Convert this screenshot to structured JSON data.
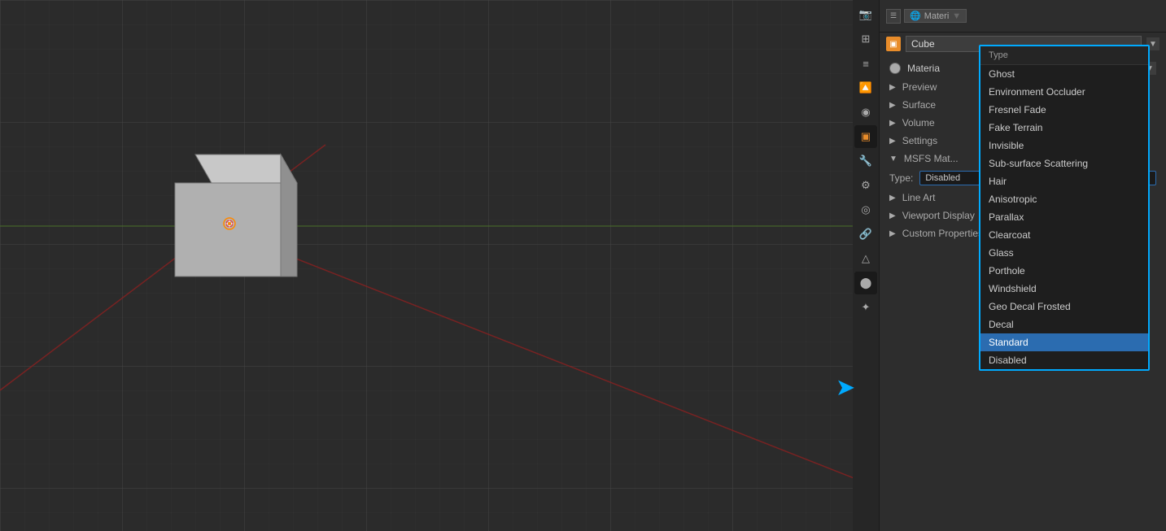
{
  "viewport": {
    "background": "#2b2b2b"
  },
  "object": {
    "name": "Cube",
    "icon": "▣"
  },
  "panel": {
    "material_name": "Materia",
    "sections": [
      {
        "label": "Preview",
        "expanded": false
      },
      {
        "label": "Surface",
        "expanded": false
      },
      {
        "label": "Volume",
        "expanded": false
      },
      {
        "label": "Settings",
        "expanded": false
      },
      {
        "label": "MSFS Mat...",
        "expanded": false
      },
      {
        "label": "Line Art",
        "expanded": false
      },
      {
        "label": "Viewport Display",
        "expanded": false
      },
      {
        "label": "Custom Properties",
        "expanded": false
      }
    ],
    "type_label": "Type:",
    "type_value": "Disabled"
  },
  "dropdown": {
    "header": "Type",
    "items": [
      {
        "label": "Ghost",
        "selected": false
      },
      {
        "label": "Environment Occluder",
        "selected": false
      },
      {
        "label": "Fresnel Fade",
        "selected": false
      },
      {
        "label": "Fake Terrain",
        "selected": false
      },
      {
        "label": "Invisible",
        "selected": false
      },
      {
        "label": "Sub-surface Scattering",
        "selected": false
      },
      {
        "label": "Hair",
        "selected": false
      },
      {
        "label": "Anisotropic",
        "selected": false
      },
      {
        "label": "Parallax",
        "selected": false
      },
      {
        "label": "Clearcoat",
        "selected": false
      },
      {
        "label": "Glass",
        "selected": false
      },
      {
        "label": "Porthole",
        "selected": false
      },
      {
        "label": "Windshield",
        "selected": false
      },
      {
        "label": "Geo Decal Frosted",
        "selected": false
      },
      {
        "label": "Decal",
        "selected": false
      },
      {
        "label": "Standard",
        "selected": true
      },
      {
        "label": "Disabled",
        "selected": false
      }
    ]
  },
  "props_icons": [
    {
      "name": "render-icon",
      "symbol": "📷",
      "active": false
    },
    {
      "name": "output-icon",
      "symbol": "⊞",
      "active": false
    },
    {
      "name": "viewlayer-icon",
      "symbol": "☰",
      "active": false
    },
    {
      "name": "scene-icon",
      "symbol": "🔼",
      "active": false
    },
    {
      "name": "world-icon",
      "symbol": "⦿",
      "active": false
    },
    {
      "name": "object-icon",
      "symbol": "▣",
      "active": false
    },
    {
      "name": "modifier-icon",
      "symbol": "🔧",
      "active": false
    },
    {
      "name": "particle-icon",
      "symbol": "⚙",
      "active": false
    },
    {
      "name": "physics-icon",
      "symbol": "◎",
      "active": false
    },
    {
      "name": "constraint-icon",
      "symbol": "🔗",
      "active": false
    },
    {
      "name": "data-icon",
      "symbol": "△",
      "active": false
    },
    {
      "name": "material-icon",
      "symbol": "⬤",
      "active": true
    },
    {
      "name": "shaderfx-icon",
      "symbol": "✦",
      "active": false
    }
  ]
}
